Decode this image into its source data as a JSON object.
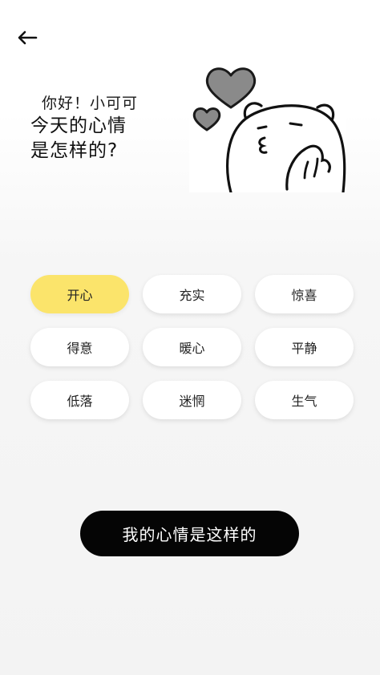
{
  "header": {
    "back_icon": "arrow-left-icon",
    "greeting": "你好！小可可",
    "question_line1": "今天的心情",
    "question_line2": "是怎样的?"
  },
  "illustration": {
    "name": "bear-with-hearts-illustration",
    "heart_color": "#8a8a8a"
  },
  "moods": {
    "selected": "开心",
    "items": [
      {
        "label": "开心"
      },
      {
        "label": "充实"
      },
      {
        "label": "惊喜"
      },
      {
        "label": "得意"
      },
      {
        "label": "暖心"
      },
      {
        "label": "平静"
      },
      {
        "label": "低落"
      },
      {
        "label": "迷惘"
      },
      {
        "label": "生气"
      }
    ]
  },
  "submit": {
    "label": "我的心情是这样的"
  },
  "colors": {
    "selected_chip": "#fbe46b",
    "chip": "#ffffff",
    "button": "#050505",
    "button_text": "#ffffff"
  }
}
